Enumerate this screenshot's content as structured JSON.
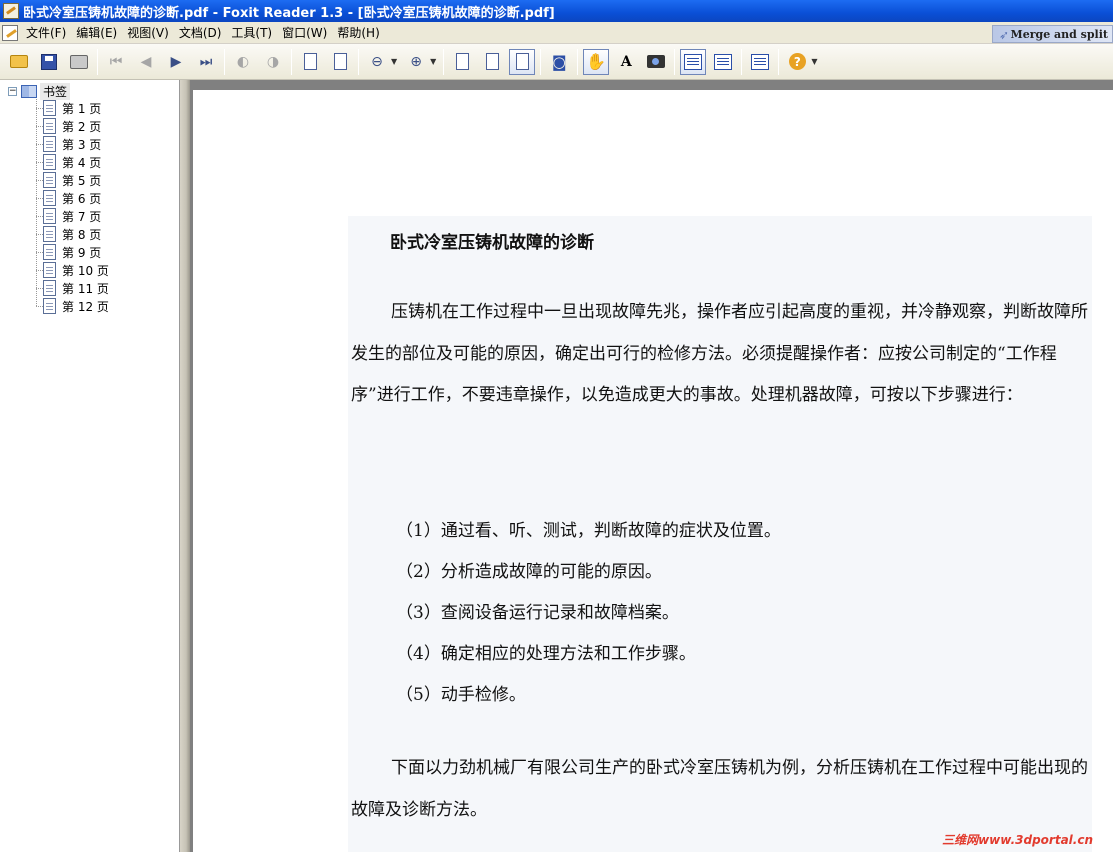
{
  "window": {
    "title": "卧式冷室压铸机故障的诊断.pdf - Foxit Reader 1.3 - [卧式冷室压铸机故障的诊断.pdf]"
  },
  "menu": {
    "items": [
      "文件(F)",
      "编辑(E)",
      "视图(V)",
      "文档(D)",
      "工具(T)",
      "窗口(W)",
      "帮助(H)"
    ],
    "merge_split": "Merge and split"
  },
  "sidebar": {
    "root": "书签",
    "pages": [
      "第 1 页",
      "第 2 页",
      "第 3 页",
      "第 4 页",
      "第 5 页",
      "第 6 页",
      "第 7 页",
      "第 8 页",
      "第 9 页",
      "第 10 页",
      "第 11 页",
      "第 12 页"
    ]
  },
  "document": {
    "title": "卧式冷室压铸机故障的诊断",
    "para1": "压铸机在工作过程中一旦出现故障先兆，操作者应引起高度的重视，并冷静观察，判断故障所发生的部位及可能的原因，确定出可行的检修方法。必须提醒操作者：应按公司制定的“工作程序”进行工作，不要违章操作，以免造成更大的事故。处理机器故障，可按以下步骤进行：",
    "steps": [
      "（1）通过看、听、测试，判断故障的症状及位置。",
      "（2）分析造成故障的可能的原因。",
      "（3）查阅设备运行记录和故障档案。",
      "（4）确定相应的处理方法和工作步骤。",
      "（5）动手检修。"
    ],
    "para2": "下面以力劲机械厂有限公司生产的卧式冷室压铸机为例，分析压铸机在工作过程中可能出现的故障及诊断方法。"
  },
  "watermark": "三维网www.3dportal.cn"
}
